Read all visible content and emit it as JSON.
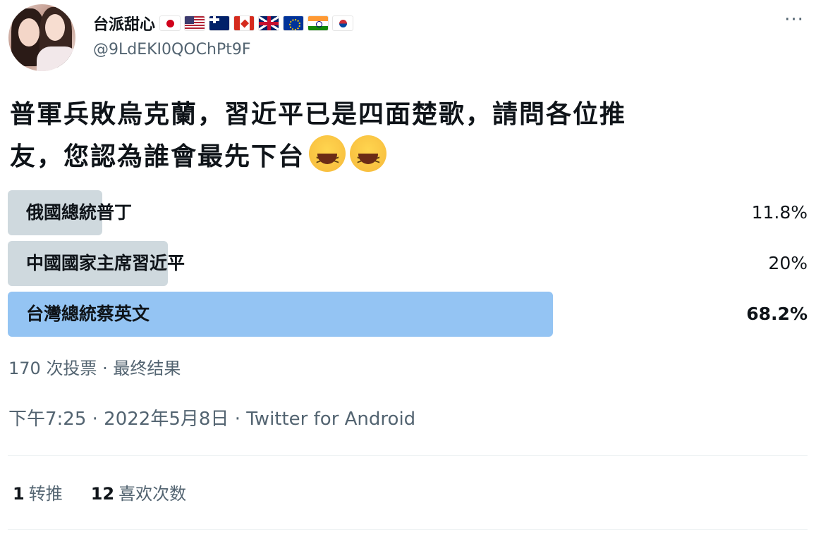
{
  "user": {
    "display_name": "台派甜心",
    "handle": "@9LdEKI0QOChPt9F",
    "flags": [
      "japan-flag-icon",
      "usa-flag-icon",
      "australia-flag-icon",
      "canada-flag-icon",
      "uk-flag-icon",
      "eu-flag-icon",
      "india-flag-icon",
      "south-korea-flag-icon"
    ]
  },
  "menu": {
    "more_label": "···"
  },
  "tweet": {
    "text_line1": "普軍兵敗烏克蘭，習近平已是四面楚歌，請問各位推",
    "text_line2": "友，您認為誰會最先下台",
    "emojis": [
      "grinning-squinting-face-icon",
      "grinning-squinting-face-icon"
    ]
  },
  "poll": {
    "options": [
      {
        "label": "俄國總統普丁",
        "percent_label": "11.8%",
        "percent": 11.8
      },
      {
        "label": "中國國家主席習近平",
        "percent_label": "20%",
        "percent": 20
      },
      {
        "label": "台灣總統蔡英文",
        "percent_label": "68.2%",
        "percent": 68.2,
        "winner": true
      }
    ],
    "summary": "170 次投票 · 最终结果"
  },
  "meta": {
    "timestamp": "下午7:25 · 2022年5月8日 · Twitter for Android"
  },
  "stats": {
    "retweets_count": "1",
    "retweets_label": "转推",
    "likes_count": "12",
    "likes_label": "喜欢次数"
  },
  "colors": {
    "bar": "#cfd9de",
    "winner_bar": "#94c4f3",
    "secondary_text": "#536471"
  }
}
